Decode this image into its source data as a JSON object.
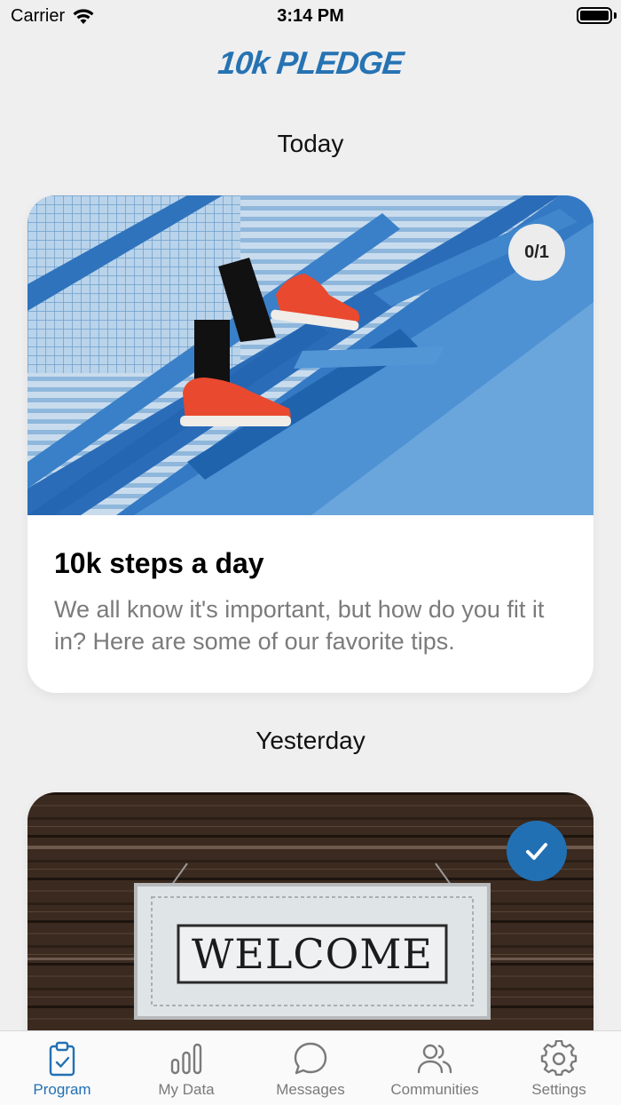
{
  "status_bar": {
    "carrier": "Carrier",
    "time": "3:14 PM"
  },
  "app": {
    "logo": "10k PLEDGE"
  },
  "sections": [
    {
      "heading": "Today",
      "card": {
        "title": "10k steps a day",
        "description": "We all know it's important, but how do you fit it in? Here are some of our favorite tips.",
        "progress": "0/1"
      }
    },
    {
      "heading": "Yesterday",
      "card": {
        "sign_text": "WELCOME",
        "completed": true
      }
    }
  ],
  "tabs": [
    {
      "label": "Program",
      "icon": "clipboard-check-icon",
      "active": true
    },
    {
      "label": "My Data",
      "icon": "bar-chart-icon",
      "active": false
    },
    {
      "label": "Messages",
      "icon": "chat-bubble-icon",
      "active": false
    },
    {
      "label": "Communities",
      "icon": "people-icon",
      "active": false
    },
    {
      "label": "Settings",
      "icon": "gear-icon",
      "active": false
    }
  ],
  "colors": {
    "accent": "#2270b4",
    "background": "#efeff0",
    "card": "#ffffff"
  }
}
